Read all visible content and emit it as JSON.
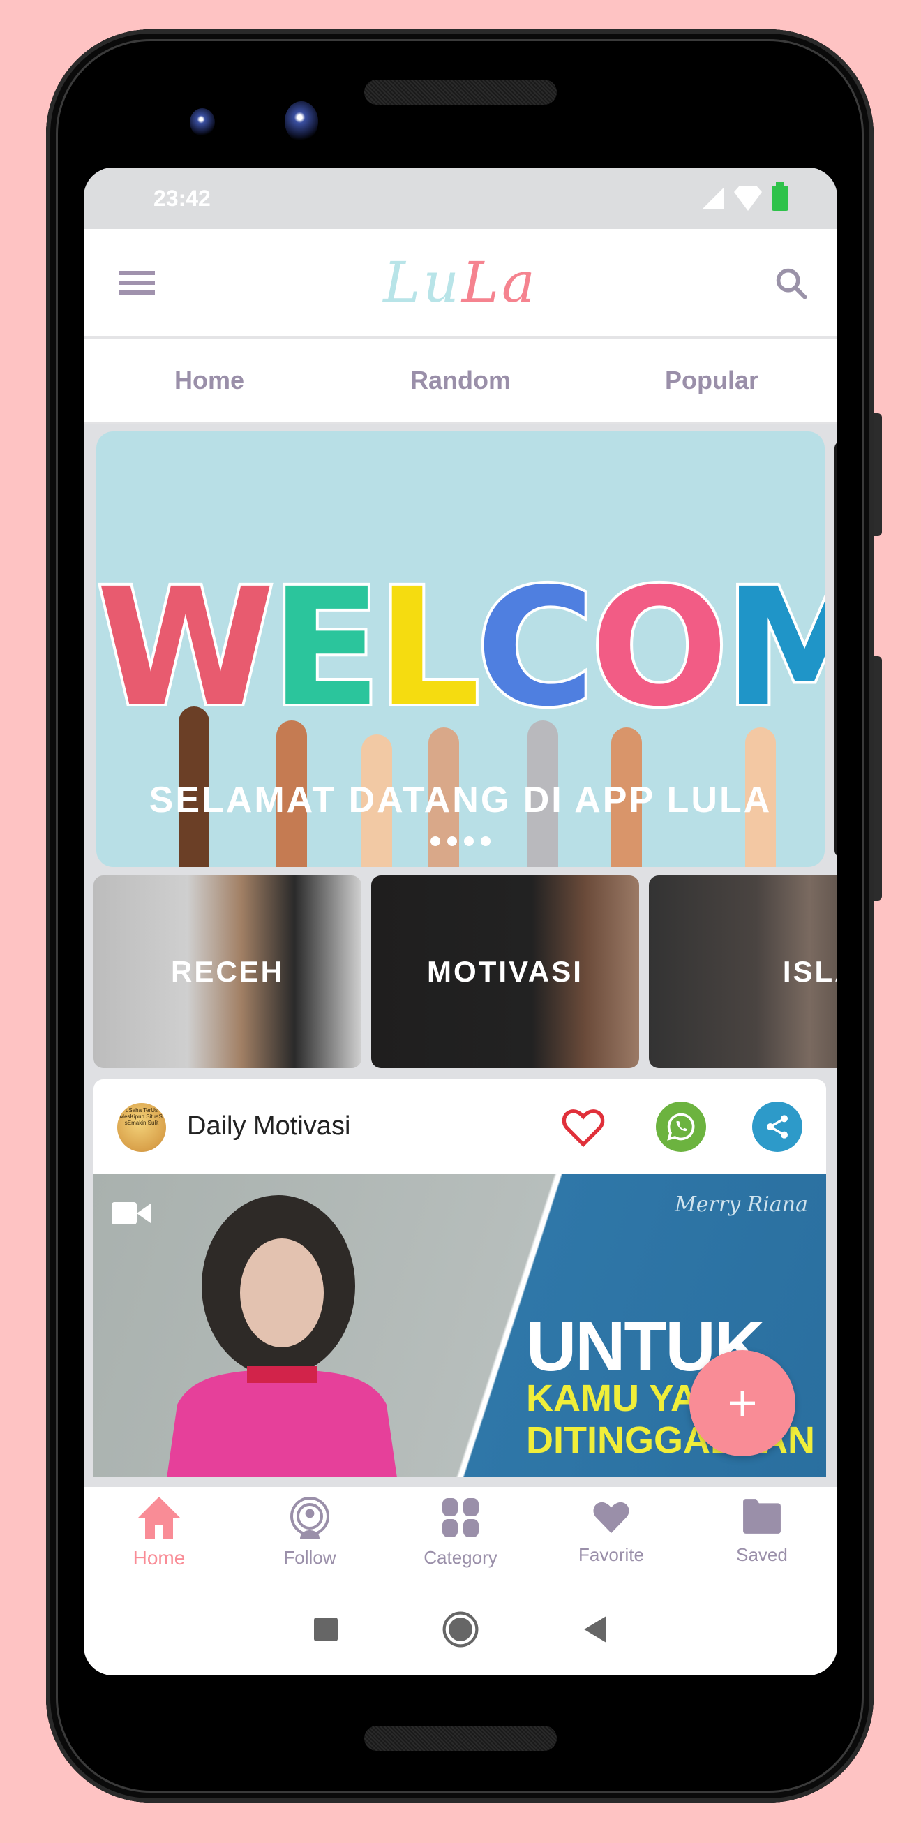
{
  "status_bar": {
    "time": "23:42",
    "icons": [
      "signal-icon",
      "wifi-icon",
      "battery-icon"
    ],
    "battery_color": "#2ec24a"
  },
  "app_bar": {
    "logo_part1": "Lu",
    "logo_part2": "La",
    "logo_colors": [
      "#b8e4e8",
      "#f5838f"
    ],
    "menu_icon": "hamburger-menu-icon",
    "search_icon": "search-icon"
  },
  "tabs": [
    {
      "label": "Home"
    },
    {
      "label": "Random"
    },
    {
      "label": "Popular"
    }
  ],
  "banner": {
    "image_text": "WELCOME",
    "caption": "SELAMAT DATANG DI APP LULA",
    "slide_count": 4,
    "active_slide": 1
  },
  "categories": [
    {
      "label": "RECEH"
    },
    {
      "label": "MOTIVASI"
    },
    {
      "label": "ISLAMI"
    }
  ],
  "post": {
    "channel_name": "Daily Motivasi",
    "avatar_text": "uSaha TerUs MesKipun SituaSi sEmakin Sulit",
    "media_type": "video",
    "media_text_line1": "UNTUK",
    "media_text_line2": "KAMU YANG",
    "media_text_line3": "DITINGGALKAN",
    "media_signature": "Merry Riana",
    "actions": {
      "favorite_icon": "heart-outline-icon",
      "whatsapp_icon": "whatsapp-icon",
      "share_icon": "share-icon"
    }
  },
  "fab": {
    "icon": "plus-icon",
    "color": "#f98c96"
  },
  "bottom_nav": {
    "active_color": "#f98c96",
    "inactive_color": "#9a8fa9",
    "items": [
      {
        "label": "Home",
        "icon": "home-icon",
        "active": true
      },
      {
        "label": "Follow",
        "icon": "podcast-icon",
        "active": false
      },
      {
        "label": "Category",
        "icon": "category-grid-icon",
        "active": false
      },
      {
        "label": "Favorite",
        "icon": "heart-icon",
        "active": false
      },
      {
        "label": "Saved",
        "icon": "folder-icon",
        "active": false
      }
    ]
  },
  "system_nav": [
    "recents-icon",
    "home-circle-icon",
    "back-icon"
  ]
}
